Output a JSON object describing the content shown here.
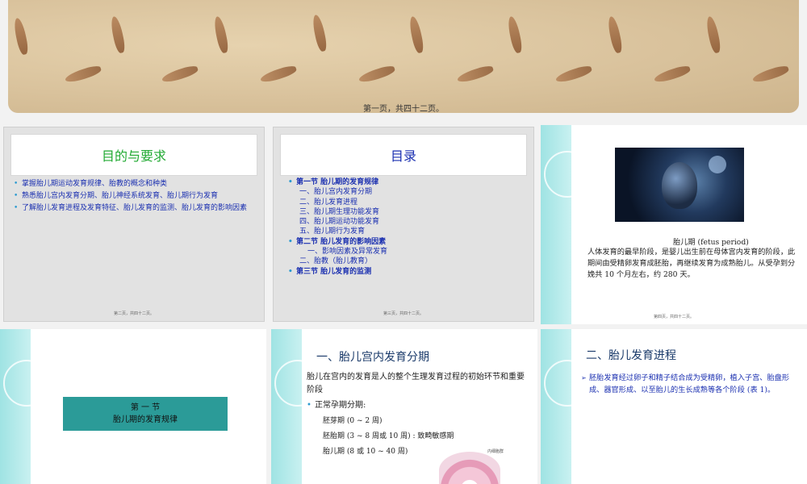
{
  "slide1": {
    "footer": "第一页，共四十二页。"
  },
  "slide2": {
    "title": "目的与要求",
    "title_color": "#22aa33",
    "bullets": [
      "掌握胎儿期运动发育规律、胎教的概念和种类",
      "熟悉胎儿宫内发育分期、胎儿神经系统发育、胎儿期行为发育",
      "了解胎儿发育进程及发育特征、胎儿发育的监测、胎儿发育的影响因素"
    ],
    "footer": "第二页，共四十二页。"
  },
  "slide3": {
    "title": "目录",
    "title_color": "#1a2fb0",
    "toc": [
      {
        "text": "第一节  胎儿期的发育规律",
        "level": "h"
      },
      {
        "text": "一、胎儿宫内发育分期",
        "level": "s"
      },
      {
        "text": "二、胎儿发育进程",
        "level": "s"
      },
      {
        "text": "三、胎儿期生理功能发育",
        "level": "s"
      },
      {
        "text": "四、胎儿期运动功能发育",
        "level": "s"
      },
      {
        "text": "五、胎儿期行为发育",
        "level": "s"
      },
      {
        "text": "第二节  胎儿发育的影响因素",
        "level": "h"
      },
      {
        "text": "一、影响因素及异常发育",
        "level": "s"
      },
      {
        "text": "二、胎教（胎儿教育）",
        "level": "s"
      },
      {
        "text": "第三节  胎儿发育的监测",
        "level": "h"
      }
    ],
    "footer": "第三页，共四十二页。"
  },
  "slide4": {
    "caption": "胎儿期 (fetus period)",
    "body": "人体发育的最早阶段，是婴儿出生前在母体宫内发育的阶段，此期间由受精卵发育成胚胎，再继续发育为成熟胎儿。从受孕到分娩共  10 个月左右，约 280 天。",
    "footer": "第四页，共四十二页。"
  },
  "slide5": {
    "box_line1": "第 一 节",
    "box_line2": "胎儿期的发育规律"
  },
  "slide6": {
    "title": "一、胎儿宫内发育分期",
    "intro": "胎儿在宫内的发育是人的整个生理发育过程的初始环节和重要阶段",
    "bullet": "正常孕期分期:",
    "periods": [
      "胚芽期 (0 ~ 2 周)",
      "胚胎期 (3 ~ 8 周或 10 周) : 致畸敏感期",
      "胎儿期 (8 或 10 ~ 40 周)"
    ],
    "diagram_label": "内细胞群"
  },
  "slide7": {
    "title": "二、胎儿发育进程",
    "body": "胚胎发育经过卵子和精子结合成为受精卵，植入子宫、胎盘形成、器官形成、以至胎儿的生长成熟等各个阶段 (表 1)。"
  }
}
